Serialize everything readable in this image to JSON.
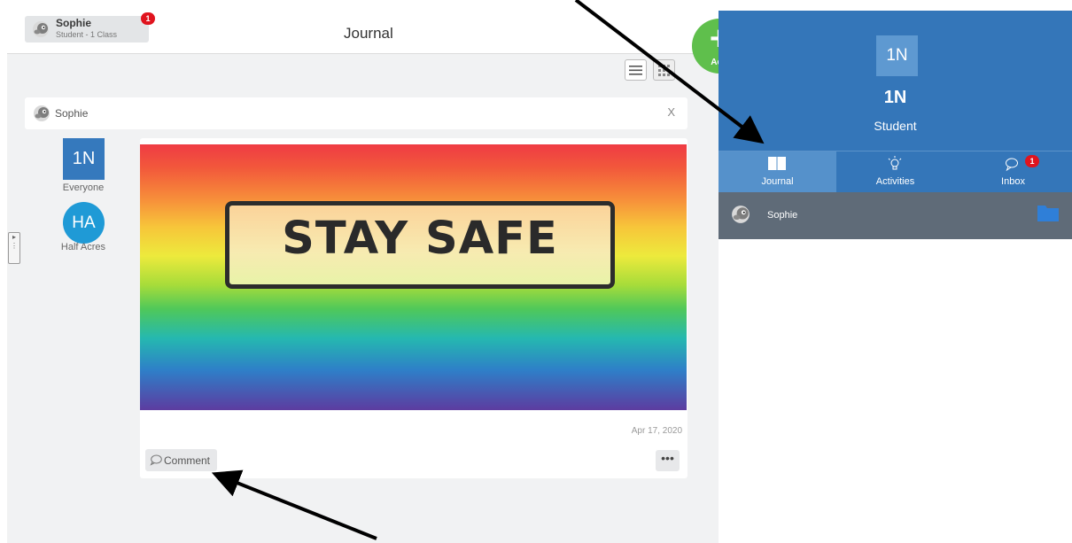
{
  "header": {
    "user_name": "Sophie",
    "user_sub": "Student - 1 Class",
    "notification_count": "1",
    "page_title": "Journal"
  },
  "filter": {
    "name": "Sophie",
    "close_label": "X"
  },
  "sidebar": {
    "class_tile": "1N",
    "class_label": "Everyone",
    "group_tile": "HA",
    "group_label": "Half Acres"
  },
  "post": {
    "image_text": "STAY SAFE",
    "date": "Apr 17, 2020",
    "comment_label": "Comment",
    "more_label": "•••"
  },
  "add_button": {
    "label": "Add"
  },
  "right_panel": {
    "tile": "1N",
    "title": "1N",
    "subtitle": "Student",
    "tabs": [
      {
        "label": "Journal",
        "icon": "book-icon",
        "active": true
      },
      {
        "label": "Activities",
        "icon": "lightbulb-icon",
        "active": false
      },
      {
        "label": "Inbox",
        "icon": "chat-icon",
        "active": false,
        "badge": "1"
      }
    ],
    "student": {
      "name": "Sophie",
      "icon": "folder-icon"
    }
  },
  "colors": {
    "primary_blue": "#3476b9",
    "active_tab": "#5591cb",
    "add_green": "#5fbf4c",
    "badge_red": "#e0141e",
    "student_row": "#5f6b78"
  }
}
